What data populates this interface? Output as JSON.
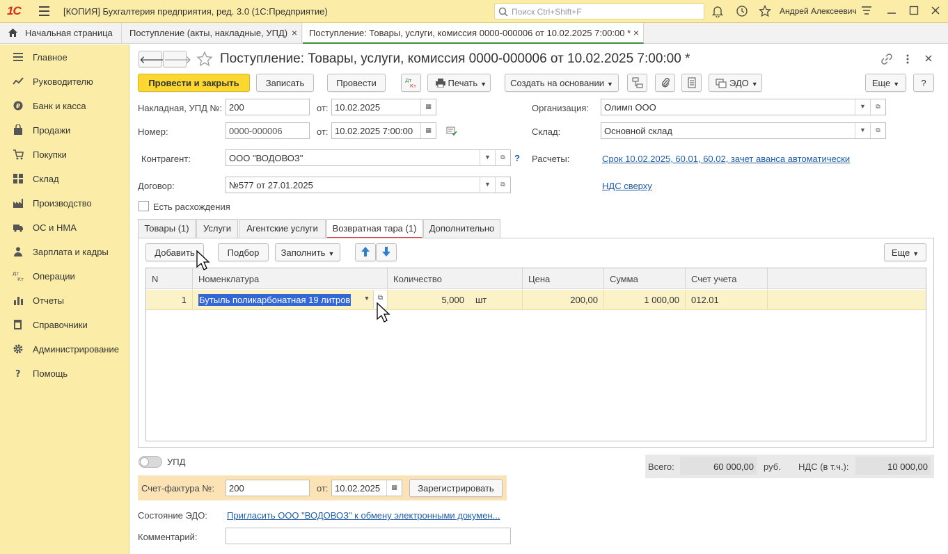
{
  "app": {
    "logo": "1С",
    "title": "[КОПИЯ] Бухгалтерия предприятия, ред. 3.0  (1С:Предприятие)",
    "search_placeholder": "Поиск Ctrl+Shift+F",
    "user": "Андрей Алексеевич"
  },
  "window_tabs": [
    {
      "label": "Начальная страница"
    },
    {
      "label": "Поступление (акты, накладные, УПД)"
    },
    {
      "label": "Поступление: Товары, услуги, комиссия 0000-000006 от 10.02.2025 7:00:00 *"
    }
  ],
  "sidebar": {
    "items": [
      {
        "label": "Главное",
        "icon": "menu-icon"
      },
      {
        "label": "Руководителю",
        "icon": "trend-icon"
      },
      {
        "label": "Банк и касса",
        "icon": "coin-icon"
      },
      {
        "label": "Продажи",
        "icon": "bag-icon"
      },
      {
        "label": "Покупки",
        "icon": "cart-icon"
      },
      {
        "label": "Склад",
        "icon": "warehouse-icon"
      },
      {
        "label": "Производство",
        "icon": "factory-icon"
      },
      {
        "label": "ОС и НМА",
        "icon": "truck-icon"
      },
      {
        "label": "Зарплата и кадры",
        "icon": "people-icon"
      },
      {
        "label": "Операции",
        "icon": "dt-kt-icon"
      },
      {
        "label": "Отчеты",
        "icon": "bar-chart-icon"
      },
      {
        "label": "Справочники",
        "icon": "book-icon"
      },
      {
        "label": "Администрирование",
        "icon": "gear-icon"
      },
      {
        "label": "Помощь",
        "icon": "question-icon"
      }
    ]
  },
  "form": {
    "title": "Поступление: Товары, услуги, комиссия 0000-000006 от 10.02.2025 7:00:00 *",
    "toolbar": {
      "post_close": "Провести и закрыть",
      "write": "Записать",
      "post": "Провести",
      "print": "Печать",
      "create_based": "Создать на основании",
      "edo": "ЭДО",
      "more": "Еще",
      "help": "?"
    },
    "fields": {
      "invoice_label": "Накладная, УПД №:",
      "invoice_value": "200",
      "from_label": "от:",
      "invoice_date": "10.02.2025",
      "number_label": "Номер:",
      "number_value": "0000-000006",
      "number_date": "10.02.2025  7:00:00",
      "org_label": "Организация:",
      "org_value": "Олимп ООО",
      "warehouse_label": "Склад:",
      "warehouse_value": "Основной склад",
      "counterparty_label": "Контрагент:",
      "counterparty_value": "ООО \"ВОДОВОЗ\"",
      "settlements_label": "Расчеты:",
      "settlements_link": "Срок 10.02.2025, 60.01, 60.02, зачет аванса автоматически",
      "contract_label": "Договор:",
      "contract_value": "№577 от 27.01.2025",
      "vat_link": "НДС сверху",
      "discrepancy_label": "Есть расхождения",
      "question": "?"
    },
    "tabs": [
      {
        "label": "Товары (1)"
      },
      {
        "label": "Услуги"
      },
      {
        "label": "Агентские услуги"
      },
      {
        "label": "Возвратная тара (1)"
      },
      {
        "label": "Дополнительно"
      }
    ],
    "table_toolbar": {
      "add": "Добавить",
      "pick": "Подбор",
      "fill": "Заполнить",
      "more": "Еще"
    },
    "table": {
      "columns": [
        "N",
        "Номенклатура",
        "Количество",
        "Цена",
        "Сумма",
        "Счет учета"
      ],
      "rows": [
        {
          "n": "1",
          "item": "Бутыль поликарбонатная 19 литров",
          "qty": "5,000",
          "unit": "шт",
          "price": "200,00",
          "sum": "1 000,00",
          "account": "012.01"
        }
      ]
    },
    "upd_label": "УПД",
    "totals": {
      "total_label": "Всего:",
      "total_value": "60 000,00",
      "currency": "руб.",
      "vat_label": "НДС (в т.ч.):",
      "vat_value": "10 000,00"
    },
    "invoice_block": {
      "label": "Счет-фактура №:",
      "value": "200",
      "from_label": "от:",
      "date": "10.02.2025",
      "register": "Зарегистрировать"
    },
    "edo_state_label": "Состояние ЭДО:",
    "edo_state_link": "Пригласить ООО \"ВОДОВОЗ\" к обмену электронными докумен...",
    "comment_label": "Комментарий:",
    "comment_value": ""
  }
}
